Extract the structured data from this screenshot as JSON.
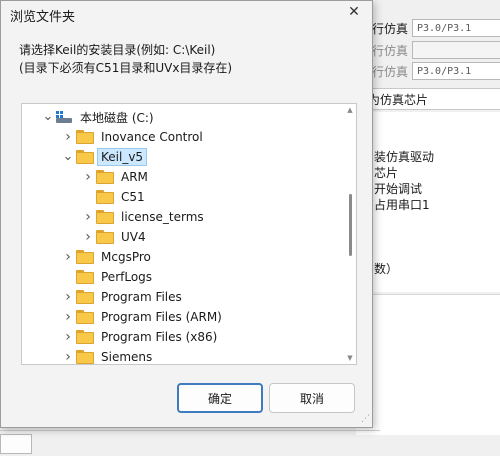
{
  "background_window": {
    "rows": [
      {
        "label": "行仿真",
        "value": "P3.0/P3.1",
        "disabled": false
      },
      {
        "label": "行仿真",
        "value": "",
        "disabled": true
      },
      {
        "label": "行仿真",
        "value": "P3.0/P3.1",
        "disabled": true
      }
    ],
    "bar_text": "为仿真芯片",
    "panel_lines": [
      "装仿真驱动",
      "芯片",
      "开始调试",
      "占用串口1",
      "数）"
    ]
  },
  "dialog": {
    "title": "浏览文件夹",
    "close_glyph": "✕",
    "description_line1": "请选择Keil的安装目录(例如: C:\\Keil)",
    "description_line2": "(目录下必须有C51目录和UVx目录存在)",
    "tree": [
      {
        "label": "本地磁盘 (C:)",
        "level": 0,
        "expander": "expanded",
        "icon": "drive-icon"
      },
      {
        "label": "Inovance Control",
        "level": 1,
        "expander": "collapsed",
        "icon": "folder-icon"
      },
      {
        "label": "Keil_v5",
        "level": 1,
        "expander": "expanded",
        "icon": "folder-icon",
        "selected": true
      },
      {
        "label": "ARM",
        "level": 2,
        "expander": "collapsed",
        "icon": "folder-icon"
      },
      {
        "label": "C51",
        "level": 2,
        "expander": "none",
        "icon": "folder-icon"
      },
      {
        "label": "license_terms",
        "level": 2,
        "expander": "collapsed",
        "icon": "folder-icon"
      },
      {
        "label": "UV4",
        "level": 2,
        "expander": "collapsed",
        "icon": "folder-icon"
      },
      {
        "label": "McgsPro",
        "level": 1,
        "expander": "collapsed",
        "icon": "folder-icon"
      },
      {
        "label": "PerfLogs",
        "level": 1,
        "expander": "none",
        "icon": "folder-icon"
      },
      {
        "label": "Program Files",
        "level": 1,
        "expander": "collapsed",
        "icon": "folder-icon"
      },
      {
        "label": "Program Files (ARM)",
        "level": 1,
        "expander": "collapsed",
        "icon": "folder-icon"
      },
      {
        "label": "Program Files (x86)",
        "level": 1,
        "expander": "collapsed",
        "icon": "folder-icon"
      },
      {
        "label": "Siemens",
        "level": 1,
        "expander": "collapsed",
        "icon": "folder-icon"
      }
    ],
    "ok_label": "确定",
    "cancel_label": "取消",
    "colors": {
      "selection_bg": "#cce8ff",
      "selection_border": "#99c9ef",
      "primary_button_border": "#3f7bbf",
      "folder_yellow": "#f8c948"
    }
  }
}
